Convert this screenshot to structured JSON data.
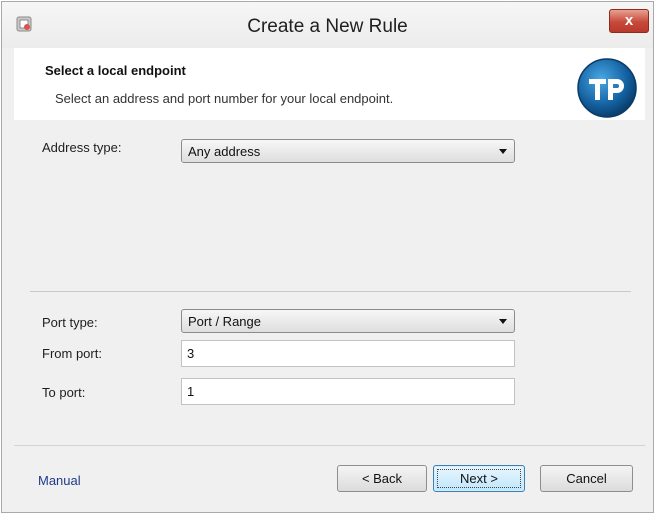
{
  "window": {
    "title": "Create a New Rule",
    "close_label": "x"
  },
  "header": {
    "title": "Select a local endpoint",
    "subtitle": "Select an address and port number for your local endpoint.",
    "logo_icon": "tp-logo"
  },
  "address": {
    "label": "Address type:",
    "selected": "Any address"
  },
  "port": {
    "type_label": "Port type:",
    "type_selected": "Port / Range",
    "from_label": "From port:",
    "from_value": "3",
    "to_label": "To port:",
    "to_value": "1"
  },
  "footer": {
    "manual_link": "Manual",
    "back_label": "< Back",
    "next_label": "Next >",
    "cancel_label": "Cancel"
  },
  "colors": {
    "accent": "#1f6fb5",
    "close": "#c7493a",
    "link": "#1f3c88"
  }
}
